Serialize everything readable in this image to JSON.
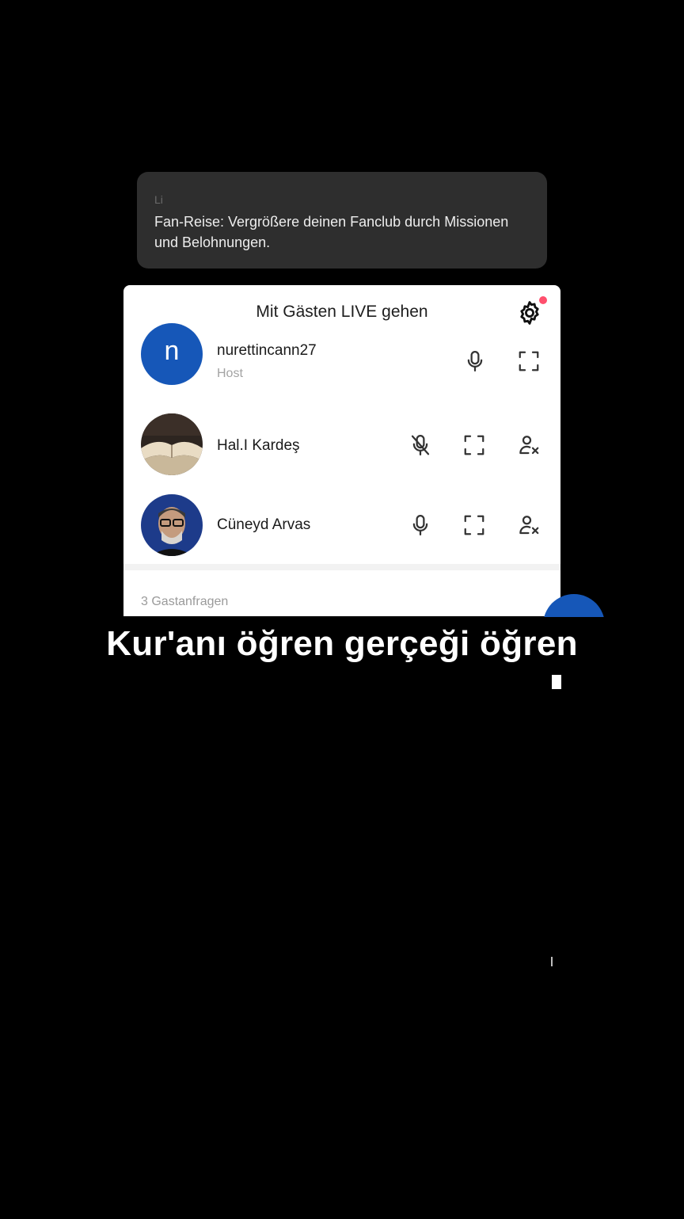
{
  "toast": {
    "ghost_text": "Li",
    "message": "Fan-Reise: Vergrößere deinen Fanclub durch Missionen und Belohnungen."
  },
  "panel": {
    "title": "Mit Gästen LIVE gehen",
    "settings_icon": "gear-icon",
    "settings_badge": "red-dot",
    "participants": [
      {
        "name": "nurettincann27",
        "role": "Host",
        "avatar_letter": "n",
        "mic": "microphone-icon",
        "mic_muted": false
      },
      {
        "name": "Hal.I Kardeş",
        "avatar": "open-book-photo",
        "mic": "microphone-muted-icon",
        "mic_muted": true
      },
      {
        "name": "Cüneyd Arvas",
        "avatar": "man-with-glasses-photo",
        "mic": "microphone-icon",
        "mic_muted": false
      }
    ],
    "guest_requests": "3 Gastanfragen"
  },
  "caption": "Kur'anı öğren gerçeği öğren",
  "colors": {
    "accent": "#1657b8",
    "badge": "#ff4f6d",
    "background": "#000000"
  }
}
